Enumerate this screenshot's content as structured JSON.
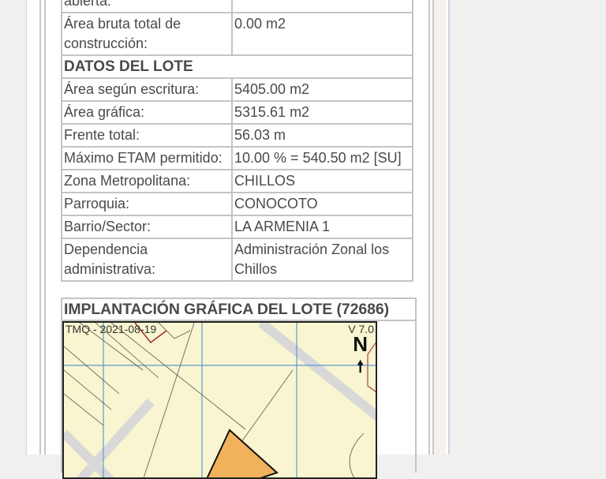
{
  "rows": [
    {
      "label": "abierta:",
      "value": ""
    },
    {
      "label": "Área bruta total de construcción:",
      "value": "0.00 m2"
    },
    {
      "section": "DATOS DEL LOTE"
    },
    {
      "label": "Área según escritura:",
      "value": "5405.00 m2"
    },
    {
      "label": "Área gráfica:",
      "value": "5315.61 m2"
    },
    {
      "label": "Frente total:",
      "value": "56.03 m"
    },
    {
      "label": "Máximo ETAM permitido:",
      "value": "10.00 % = 540.50 m2 [SU]"
    },
    {
      "label": "Zona Metropolitana:",
      "value": "CHILLOS"
    },
    {
      "label": "Parroquia:",
      "value": "CONOCOTO"
    },
    {
      "label": "Barrio/Sector:",
      "value": "LA ARMENIA 1"
    },
    {
      "label": "Dependencia administrativa:",
      "value": "Administración Zonal los Chillos"
    }
  ],
  "map": {
    "title": "IMPLANTACIÓN GRÁFICA DEL LOTE (72686)",
    "stamp": "TMQ - 2021-08-19",
    "version": "V 7.0",
    "north_label": "N",
    "lot_color": "#f2b25c"
  }
}
